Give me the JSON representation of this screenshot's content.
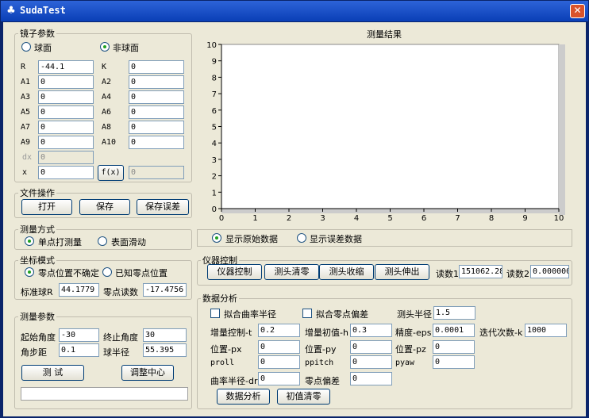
{
  "window": {
    "title": "SudaTest",
    "close": "✕"
  },
  "mirror": {
    "legend": "镜子参数",
    "radio_sphere": "球面",
    "radio_asphere": "非球面",
    "fields": [
      {
        "label": "R",
        "value": "-44.1"
      },
      {
        "label": "K",
        "value": "0"
      },
      {
        "label": "A1",
        "value": "0"
      },
      {
        "label": "A2",
        "value": "0"
      },
      {
        "label": "A3",
        "value": "0"
      },
      {
        "label": "A4",
        "value": "0"
      },
      {
        "label": "A5",
        "value": "0"
      },
      {
        "label": "A6",
        "value": "0"
      },
      {
        "label": "A7",
        "value": "0"
      },
      {
        "label": "A8",
        "value": "0"
      },
      {
        "label": "A9",
        "value": "0"
      },
      {
        "label": "A10",
        "value": "0"
      }
    ],
    "dx_label": "dx",
    "dx_value": "0",
    "x_label": "x",
    "x_value": "0",
    "fx_button": "f(x)",
    "fx_value": "0"
  },
  "file": {
    "legend": "文件操作",
    "open": "打开",
    "save": "保存",
    "save_error": "保存误差"
  },
  "measure_mode": {
    "legend": "测量方式",
    "single": "单点打测量",
    "slide": "表面滑动"
  },
  "coord": {
    "legend": "坐标模式",
    "unknown": "零点位置不确定",
    "known": "已知零点位置",
    "ball_r_label": "标准球R",
    "ball_r": "44.1779",
    "zero_label": "零点读数",
    "zero": "-17.4756"
  },
  "params": {
    "legend": "测量参数",
    "start_label": "起始角度",
    "start": "-30",
    "end_label": "终止角度",
    "end": "30",
    "step_label": "角步距",
    "step": "0.1",
    "radius_label": "球半径",
    "radius": "55.395",
    "test": "测 试",
    "center": "调整中心"
  },
  "result": {
    "title": "测量结果"
  },
  "chart_data": {
    "type": "line",
    "title": "测量结果",
    "xlabel": "",
    "ylabel": "",
    "xlim": [
      0,
      10
    ],
    "ylim": [
      0,
      10
    ],
    "xticks": [
      0,
      1,
      2,
      3,
      4,
      5,
      6,
      7,
      8,
      9,
      10
    ],
    "yticks": [
      0,
      1,
      2,
      3,
      4,
      5,
      6,
      7,
      8,
      9,
      10
    ],
    "grid": false,
    "series": []
  },
  "display": {
    "raw": "显示原始数据",
    "error": "显示误差数据"
  },
  "instrument": {
    "legend": "仪器控制",
    "control": "仪器控制",
    "clear": "测头清零",
    "retract": "测头收缩",
    "extend": "测头伸出",
    "read1_label": "读数1",
    "read1": "151062.28",
    "read2_label": "读数2",
    "read2": "0.000000"
  },
  "analysis": {
    "legend": "数据分析",
    "fit_r": "拟合曲率半径",
    "fit_zero": "拟合零点偏差",
    "probe_r_label": "测头半径",
    "probe_r": "1.5",
    "t_label": "增量控制-t",
    "t": "0.2",
    "h_label": "增量初值-h",
    "h": "0.3",
    "eps_label": "精度-eps",
    "eps": "0.0001",
    "k_label": "迭代次数-k",
    "k": "1000",
    "px_label": "位置-px",
    "px": "0",
    "py_label": "位置-py",
    "py": "0",
    "pz_label": "位置-pz",
    "pz": "0",
    "proll_label": "proll",
    "proll": "0",
    "ppitch_label": "ppitch",
    "ppitch": "0",
    "pyaw_label": "pyaw",
    "pyaw": "0",
    "dr_label": "曲率半径-dr",
    "dr": "0",
    "zerodev_label": "零点偏差",
    "zerodev": "0",
    "analyze": "数据分析",
    "reset": "初值清零"
  }
}
